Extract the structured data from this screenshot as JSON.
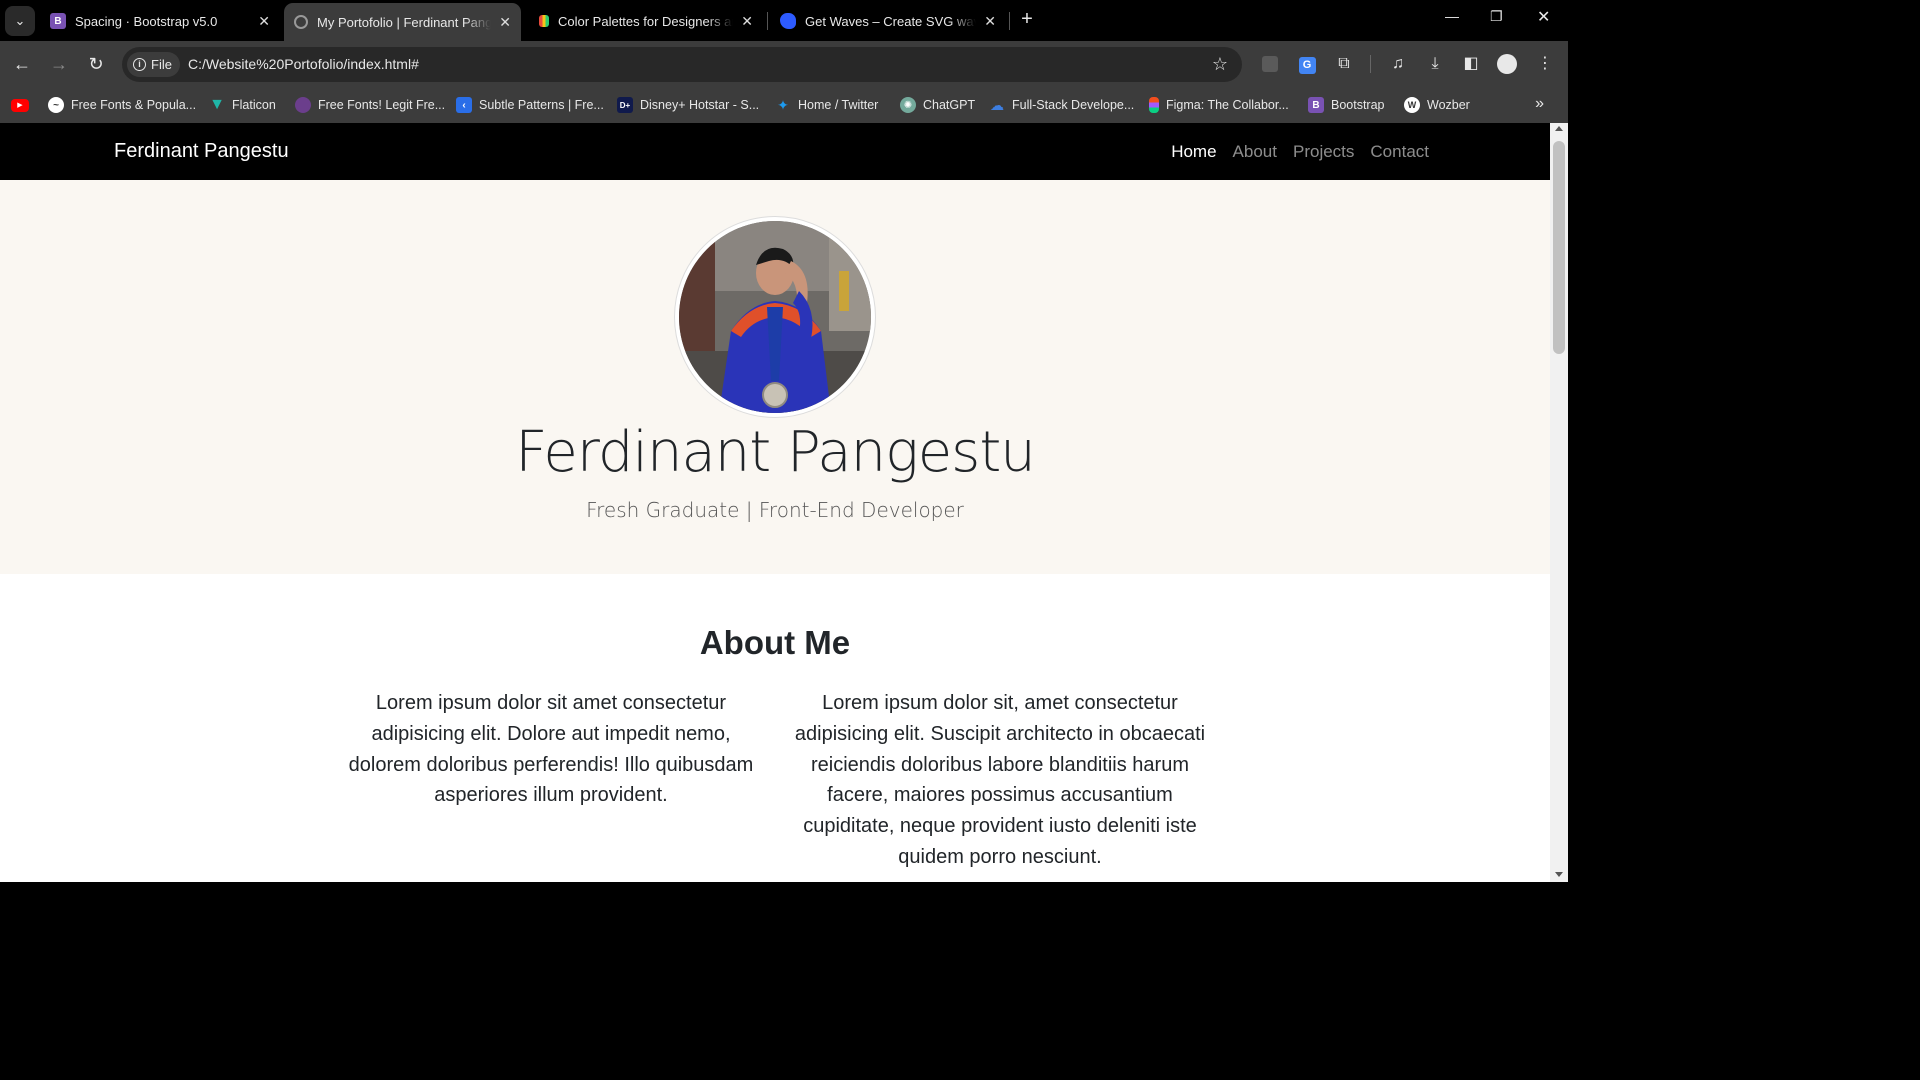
{
  "browser": {
    "tabs": [
      {
        "title": "Spacing · Bootstrap v5.0",
        "favicon_letter": "B",
        "favicon_color": "#7952b3",
        "active": false
      },
      {
        "title": "My Portofolio | Ferdinant Pangestu",
        "favicon_letter": "",
        "favicon_color": "#777",
        "active": true
      },
      {
        "title": "Color Palettes for Designers and Artists",
        "favicon_letter": "",
        "favicon_color": "#e8b400",
        "active": false
      },
      {
        "title": "Get Waves – Create SVG waves",
        "favicon_letter": "",
        "favicon_color": "#2d5bff",
        "active": false
      }
    ],
    "omnibox": {
      "chip_label": "File",
      "url": "C:/Website%20Portofolio/index.html#"
    },
    "bookmarks": [
      {
        "label": "",
        "icon": "youtube-icon",
        "color": "#ff0000"
      },
      {
        "label": "Free Fonts & Popula...",
        "icon": "fontspace-icon",
        "color": "#555"
      },
      {
        "label": "Flaticon",
        "icon": "flaticon-icon",
        "color": "#1fb6a8"
      },
      {
        "label": "Free Fonts! Legit Fre...",
        "icon": "dafont-icon",
        "color": "#6b3e8c"
      },
      {
        "label": "Subtle Patterns | Fre...",
        "icon": "subtle-patterns-icon",
        "color": "#2a6ee8"
      },
      {
        "label": "Disney+ Hotstar - S...",
        "icon": "disney-icon",
        "color": "#101a4c"
      },
      {
        "label": "Home / Twitter",
        "icon": "twitter-icon",
        "color": "#1d9bf0"
      },
      {
        "label": "ChatGPT",
        "icon": "chatgpt-icon",
        "color": "#74aa9c"
      },
      {
        "label": "Full-Stack Develope...",
        "icon": "cloud-icon",
        "color": "#3d7ee0"
      },
      {
        "label": "Figma: The Collabor...",
        "icon": "figma-icon",
        "color": "#f24e1e"
      },
      {
        "label": "Bootstrap",
        "icon": "bootstrap-icon",
        "color": "#7952b3"
      },
      {
        "label": "Wozber",
        "icon": "wozber-icon",
        "color": "#333"
      }
    ]
  },
  "site": {
    "brand": "Ferdinant Pangestu",
    "nav": [
      {
        "label": "Home",
        "active": true
      },
      {
        "label": "About",
        "active": false
      },
      {
        "label": "Projects",
        "active": false
      },
      {
        "label": "Contact",
        "active": false
      }
    ],
    "hero": {
      "name": "Ferdinant Pangestu",
      "subtitle": "Fresh Graduate | Front-End Developer"
    },
    "about": {
      "title": "About Me",
      "col1": "Lorem ipsum dolor sit amet consectetur adipisicing elit. Dolore aut impedit nemo, dolorem doloribus perferendis! Illo quibusdam asperiores illum provident.",
      "col2": "Lorem ipsum dolor sit, amet consectetur adipisicing elit. Suscipit architecto in obcaecati reiciendis doloribus labore blanditiis harum facere, maiores possimus accusantium cupiditate, neque provident iusto deleniti iste quidem porro nesciunt."
    }
  }
}
